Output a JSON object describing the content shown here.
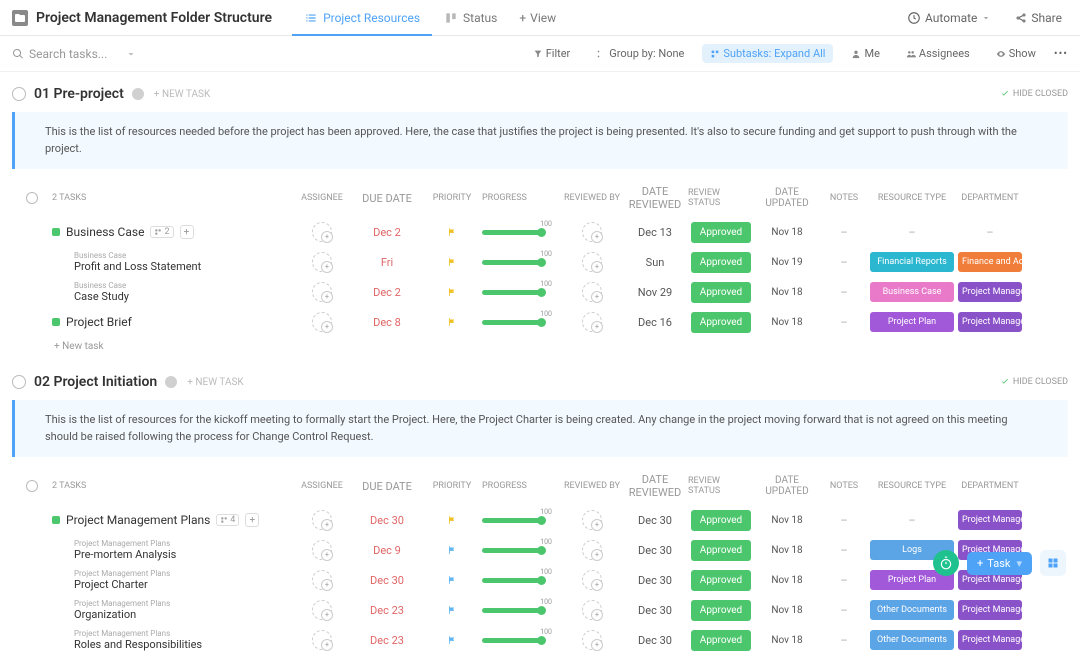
{
  "header": {
    "title": "Project Management Folder Structure",
    "tabs": [
      {
        "label": "Project Resources",
        "active": true
      },
      {
        "label": "Status",
        "active": false
      }
    ],
    "add_view": "View",
    "automate": "Automate",
    "share": "Share"
  },
  "toolbar": {
    "search_placeholder": "Search tasks...",
    "filter": "Filter",
    "group_by": "Group by: None",
    "subtasks": "Subtasks: Expand All",
    "me": "Me",
    "assignees": "Assignees",
    "show": "Show"
  },
  "columns": {
    "tasks": "2 TASKS",
    "assignee": "ASSIGNEE",
    "due_date": "DUE DATE",
    "priority": "PRIORITY",
    "progress": "PROGRESS",
    "reviewed_by": "REVIEWED BY",
    "date_reviewed": "DATE REVIEWED",
    "review_status": "REVIEW STATUS",
    "date_updated": "DATE UPDATED",
    "notes": "NOTES",
    "resource_type": "RESOURCE TYPE",
    "department": "DEPARTMENT"
  },
  "sections": [
    {
      "title": "01 Pre-project",
      "new_task": "+ NEW TASK",
      "hide_closed": "HIDE CLOSED",
      "description": "This is the list of resources needed before the project has been approved. Here, the case that justifies the project is being presented. It's also to secure funding and get support to push through with the project.",
      "tasks_label": "2 TASKS",
      "add_new": "+ New task",
      "rows": [
        {
          "type": "main",
          "name": "Business Case",
          "subcount": "2",
          "due": "Dec 2",
          "flag": "yellow",
          "progress": 100,
          "date_reviewed": "Dec 13",
          "status": "Approved",
          "updated": "Nov 18",
          "notes": "–",
          "restype": "–",
          "restype_class": "",
          "dept": "–",
          "dept_class": ""
        },
        {
          "type": "sub",
          "parent": "Business Case",
          "name": "Profit and Loss Statement",
          "due": "Fri",
          "flag": "yellow",
          "progress": 100,
          "date_reviewed": "Sun",
          "status": "Approved",
          "updated": "Nov 19",
          "notes": "–",
          "restype": "Financial Reports",
          "restype_class": "teal",
          "dept": "Finance and Accou",
          "dept_class": "orange"
        },
        {
          "type": "sub",
          "parent": "Business Case",
          "name": "Case Study",
          "due": "Dec 2",
          "flag": "yellow",
          "progress": 100,
          "date_reviewed": "Nov 29",
          "status": "Approved",
          "updated": "Nov 18",
          "notes": "–",
          "restype": "Business Case",
          "restype_class": "pink",
          "dept": "Project Managem",
          "dept_class": "purple2"
        },
        {
          "type": "main",
          "name": "Project Brief",
          "subcount": "",
          "due": "Dec 8",
          "flag": "yellow",
          "progress": 100,
          "date_reviewed": "Dec 16",
          "status": "Approved",
          "updated": "Nov 18",
          "notes": "–",
          "restype": "Project Plan",
          "restype_class": "purple",
          "dept": "Project Managem",
          "dept_class": "purple2"
        }
      ]
    },
    {
      "title": "02 Project Initiation",
      "new_task": "+ NEW TASK",
      "hide_closed": "HIDE CLOSED",
      "description": "This is the list of resources for the kickoff meeting to formally start the Project. Here, the Project Charter is being created. Any change in the project moving forward that is not agreed on this meeting should be raised following the process for Change Control Request.",
      "tasks_label": "2 TASKS",
      "rows": [
        {
          "type": "main",
          "name": "Project Management Plans",
          "subcount": "4",
          "due": "Dec 30",
          "flag": "yellow",
          "progress": 100,
          "date_reviewed": "Dec 30",
          "status": "Approved",
          "updated": "Nov 18",
          "notes": "–",
          "restype": "–",
          "restype_class": "",
          "dept": "Project Managem",
          "dept_class": "purple2"
        },
        {
          "type": "sub",
          "parent": "Project Management Plans",
          "name": "Pre-mortem Analysis",
          "due": "Dec 9",
          "flag": "blue",
          "progress": 100,
          "date_reviewed": "Dec 30",
          "status": "Approved",
          "updated": "Nov 18",
          "notes": "–",
          "restype": "Logs",
          "restype_class": "blue2",
          "dept": "Project Managem",
          "dept_class": "purple2"
        },
        {
          "type": "sub",
          "parent": "Project Management Plans",
          "name": "Project Charter",
          "due": "Dec 30",
          "flag": "blue",
          "progress": 100,
          "date_reviewed": "Dec 30",
          "status": "Approved",
          "updated": "Nov 18",
          "notes": "–",
          "restype": "Project Plan",
          "restype_class": "purple",
          "dept": "Project Managem",
          "dept_class": "purple2"
        },
        {
          "type": "sub",
          "parent": "Project Management Plans",
          "name": "Organization",
          "due": "Dec 23",
          "flag": "blue",
          "progress": 100,
          "date_reviewed": "Dec 30",
          "status": "Approved",
          "updated": "Nov 18",
          "notes": "–",
          "restype": "Other Documents",
          "restype_class": "blue2",
          "dept": "Project Managem",
          "dept_class": "purple2"
        },
        {
          "type": "sub",
          "parent": "Project Management Plans",
          "name": "Roles and Responsibilities",
          "due": "Dec 23",
          "flag": "blue",
          "progress": 100,
          "date_reviewed": "Dec 30",
          "status": "Approved",
          "updated": "Nov 18",
          "notes": "–",
          "restype": "Other Documents",
          "restype_class": "blue2",
          "dept": "Project Managem",
          "dept_class": "purple2"
        }
      ]
    }
  ],
  "bottom": {
    "task_btn": "Task"
  }
}
